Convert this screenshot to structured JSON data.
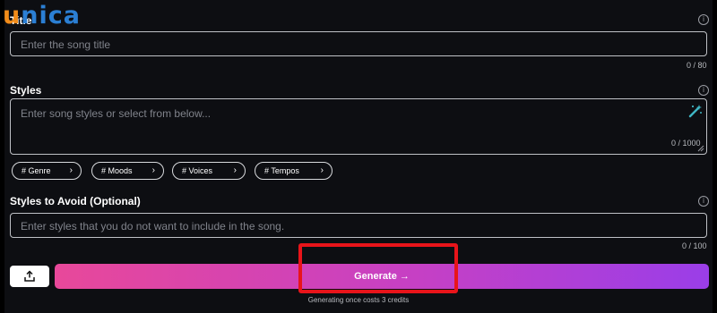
{
  "logo": {
    "first_letter": "u",
    "rest": "nica"
  },
  "title_field": {
    "label": "Title",
    "placeholder": "Enter the song title",
    "counter": "0 / 80"
  },
  "styles_field": {
    "label": "Styles",
    "placeholder": "Enter song styles or select from below...",
    "counter": "0 / 1000"
  },
  "chips": [
    {
      "label": "# Genre"
    },
    {
      "label": "# Moods"
    },
    {
      "label": "# Voices"
    },
    {
      "label": "# Tempos"
    }
  ],
  "avoid_field": {
    "label": "Styles to Avoid (Optional)",
    "placeholder": "Enter styles that you do not want to include in the song.",
    "counter": "0 / 100"
  },
  "info_glyph": "i",
  "chip_chevron": "›",
  "generate": {
    "label": "Generate →",
    "note": "Generating once costs 3 credits"
  },
  "icons": {
    "info": "info-icon",
    "upload": "upload-icon",
    "wand": "magic-wand-icon",
    "chevron": "chevron-right-icon"
  },
  "colors": {
    "background": "#0d0e12",
    "gradient_start": "#e8489a",
    "gradient_end": "#9a3ee8",
    "highlight": "#e8141a",
    "logo_orange": "#f28c1a",
    "logo_blue": "#2b7fd4"
  }
}
